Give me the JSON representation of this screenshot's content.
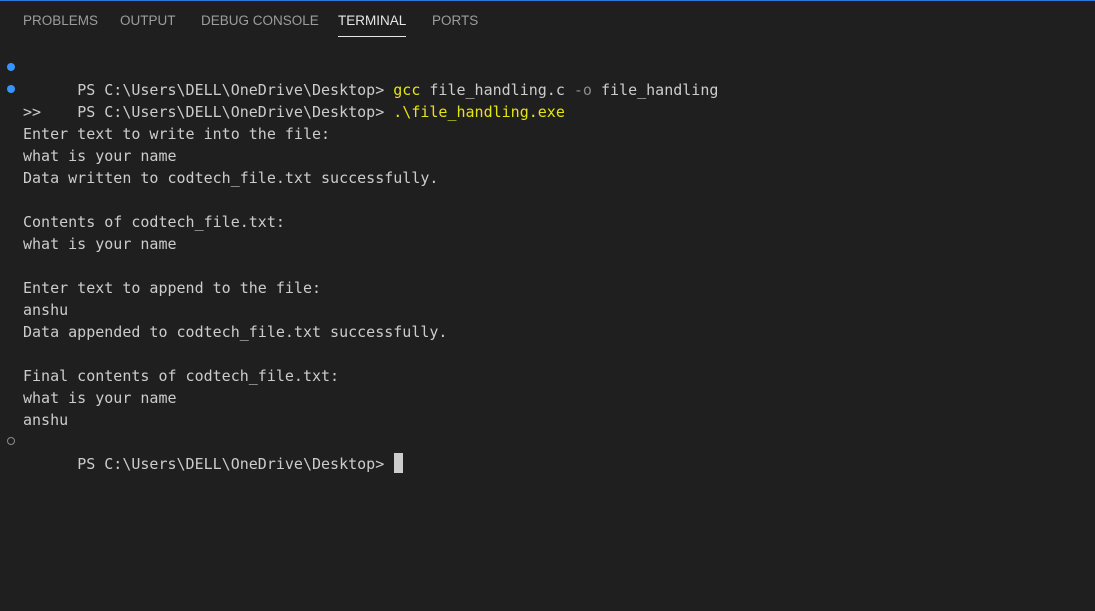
{
  "tabs": [
    {
      "label": "PROBLEMS"
    },
    {
      "label": "OUTPUT"
    },
    {
      "label": "DEBUG CONSOLE"
    },
    {
      "label": "TERMINAL"
    },
    {
      "label": "PORTS"
    }
  ],
  "terminal": {
    "prompt": "PS C:\\Users\\DELL\\OneDrive\\Desktop> ",
    "cmd1": {
      "name": "gcc",
      "arg1": " file_handling.c ",
      "flag": "-o",
      "arg2": " file_handling"
    },
    "cmd2": {
      "name": ".\\file_handling.exe"
    },
    "output": [
      ">>",
      "Enter text to write into the file:",
      "what is your name",
      "Data written to codtech_file.txt successfully.",
      "",
      "Contents of codtech_file.txt:",
      "what is your name",
      "",
      "Enter text to append to the file:",
      "anshu",
      "Data appended to codtech_file.txt successfully.",
      "",
      "Final contents of codtech_file.txt:",
      "what is your name",
      "anshu"
    ]
  },
  "colors": {
    "background": "#1f1f1f",
    "accent": "#2b79d8",
    "command": "#e5e510",
    "text": "#cccccc"
  }
}
